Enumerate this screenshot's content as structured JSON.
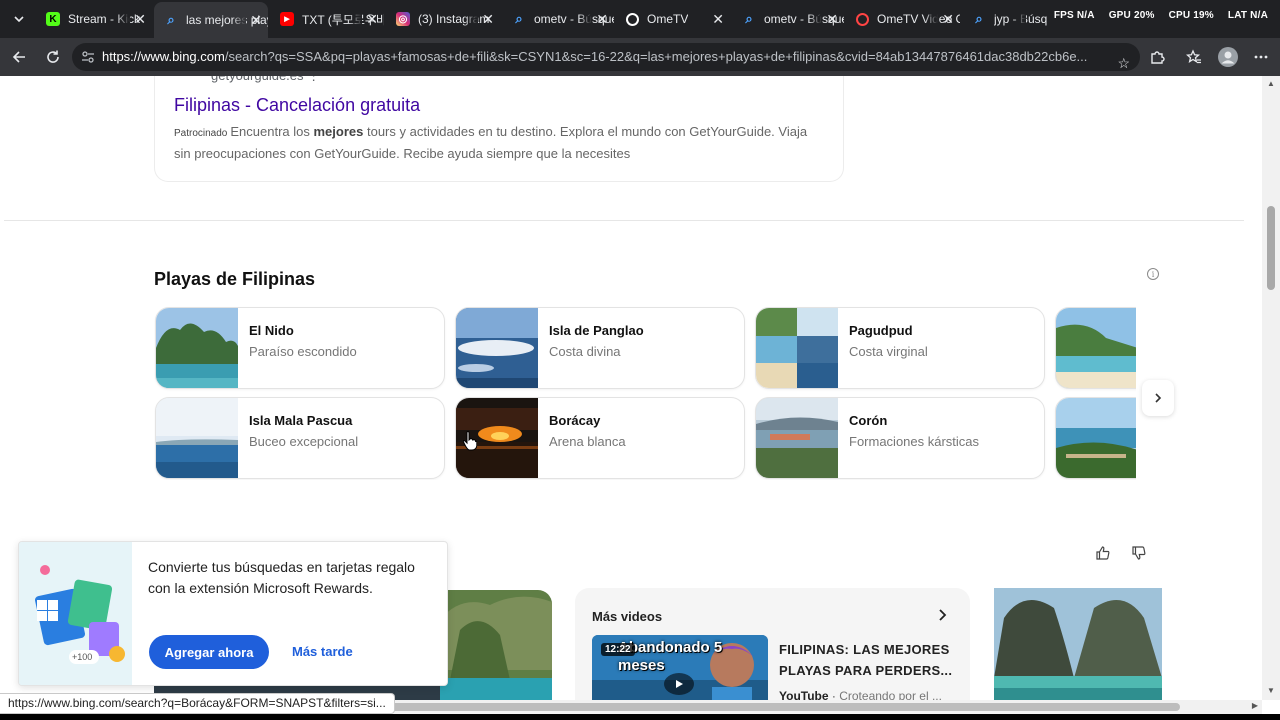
{
  "browser": {
    "tabs": [
      {
        "title": "Stream - Kick",
        "favicon": "kick-icon",
        "color": "#53fc18",
        "active": false
      },
      {
        "title": "las mejores playas",
        "favicon": "bing-search-icon",
        "color": "#4da3ff",
        "active": true
      },
      {
        "title": "TXT (투모로우바이투게더)",
        "favicon": "youtube-icon",
        "color": "#ff0000",
        "active": false
      },
      {
        "title": "(3) Instagram",
        "favicon": "instagram-icon",
        "color": "#e1306c",
        "active": false
      },
      {
        "title": "ometv - Búsqueda",
        "favicon": "bing-search-icon",
        "color": "#4da3ff",
        "active": false
      },
      {
        "title": "OmeTV",
        "favicon": "ometv-icon",
        "color": "#ffffff",
        "active": false
      },
      {
        "title": "ometv - Búsqueda",
        "favicon": "bing-search-icon",
        "color": "#4da3ff",
        "active": false
      },
      {
        "title": "OmeTV Video Chat",
        "favicon": "ometv-icon",
        "color": "#ff4444",
        "active": false
      },
      {
        "title": "jyp - Búsqueda",
        "favicon": "bing-search-icon",
        "color": "#4da3ff",
        "active": false
      }
    ],
    "overlay": {
      "fps": "FPS N/A",
      "gpu": "GPU 20%",
      "cpu": "CPU 19%",
      "lat": "LAT N/A"
    },
    "url_host": "https://www.bing.com",
    "url_rest": "/search?qs=SSA&pq=playas+famosas+de+fili&sk=CSYN1&sc=16-22&q=las+mejores+playas+de+filipinas&cvid=84ab13447876461dac38db22cb6e..."
  },
  "ad": {
    "site": "getyourguide.es ⋮",
    "title": "Filipinas - Cancelación gratuita",
    "sponsored": "Patrocinado",
    "desc_pre": "Encuentra los ",
    "desc_bold": "mejores",
    "desc_post": " tours y actividades en tu destino. Explora el mundo con GetYourGuide. Viaja sin preocupaciones con GetYourGuide. Recibe ayuda siempre que la necesites"
  },
  "beaches": {
    "title": "Playas de Filipinas",
    "items": [
      {
        "name": "El Nido",
        "sub": "Paraíso escondido"
      },
      {
        "name": "Isla de Panglao",
        "sub": "Costa divina"
      },
      {
        "name": "Pagudpud",
        "sub": "Costa virginal"
      },
      {
        "name": "",
        "sub": ""
      },
      {
        "name": "Isla Mala Pascua",
        "sub": "Buceo excepcional"
      },
      {
        "name": "Borácay",
        "sub": "Arena blanca"
      },
      {
        "name": "Corón",
        "sub": "Formaciones kársticas"
      },
      {
        "name": "",
        "sub": ""
      }
    ]
  },
  "videos": {
    "more_label": "Más videos",
    "duration": "12:22",
    "thumb_text": "Abandonado 5 meses",
    "title": "FILIPINAS: LAS MEJORES PLAYAS PARA PERDERS...",
    "source": "YouTube",
    "channel": "Croteando por el ..."
  },
  "rewards": {
    "text": "Convierte tus búsquedas en tarjetas regalo con la extensión Microsoft Rewards.",
    "cta": "Agregar ahora",
    "later": "Más tarde",
    "badge": "+100"
  },
  "status_url": "https://www.bing.com/search?q=Borácay&FORM=SNAPST&filters=si..."
}
